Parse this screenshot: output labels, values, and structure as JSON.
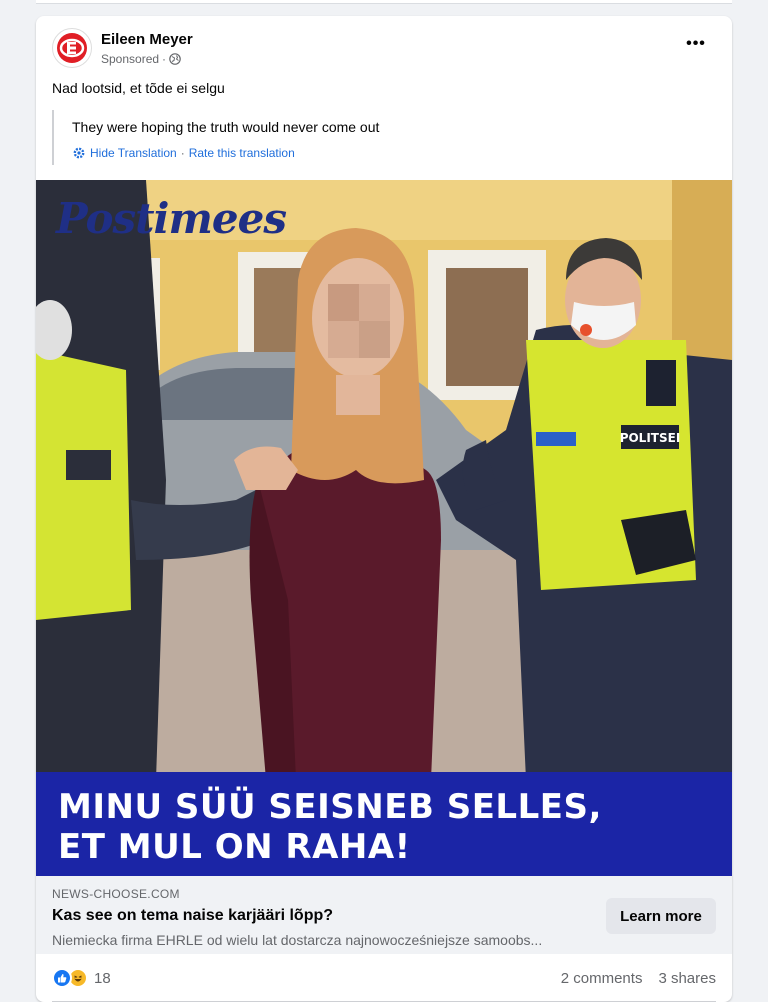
{
  "post": {
    "author": "Eileen Meyer",
    "sponsored_label": "Sponsored",
    "text": "Nad lootsid, et tõde ei selgu",
    "translation": {
      "text": "They were hoping the truth would never come out",
      "hide_link": "Hide Translation",
      "separator": "·",
      "rate_link": "Rate this translation"
    }
  },
  "ad": {
    "brand_logo": "Postimees",
    "headline_lines": [
      "MINU SÜÜ SEISNEB SELLES,",
      "ET MUL ON RAHA!"
    ],
    "domain": "NEWS-CHOOSE.COM",
    "title": "Kas see on tema naise karjääri lõpp?",
    "description": "Niemiecka firma EHRLE od wielu lat dostarcza najnowocześniejsze samoobs...",
    "cta": "Learn more"
  },
  "engagement": {
    "reaction_count": "18",
    "comments": "2 comments",
    "shares": "3 shares"
  },
  "colors": {
    "accent": "#1877f2",
    "banner": "#1b25a6",
    "link": "#216fdb"
  },
  "icons": [
    "avatar-logo-icon",
    "globe-icon",
    "more-icon",
    "gear-icon",
    "like-icon",
    "haha-icon"
  ]
}
